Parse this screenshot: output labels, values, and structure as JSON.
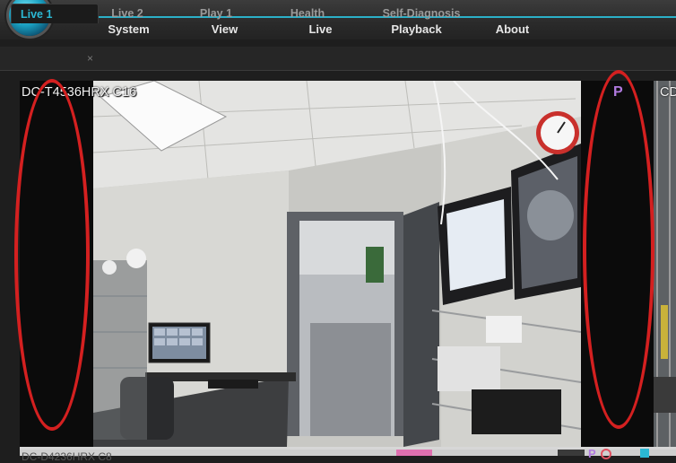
{
  "app": {
    "menu": [
      "System",
      "View",
      "Live",
      "Playback",
      "About"
    ]
  },
  "tabs": {
    "items": [
      "Live 1",
      "Live 2",
      "Play 1",
      "Health",
      "Self-Diagnosis"
    ],
    "close_symbol": "×"
  },
  "viewer": {
    "camera_label": "DC-T4536HRX C16",
    "neighbor_label": "CD",
    "ptz_badge": "P",
    "bottom_camera_label": "DC-D4236HRX C8",
    "bottom_badge": "P"
  },
  "colors": {
    "accent": "#2bb8d4",
    "annotation": "#d42020",
    "badge": "#b07adf"
  },
  "icons": {
    "logo": "globe-logo-icon"
  }
}
